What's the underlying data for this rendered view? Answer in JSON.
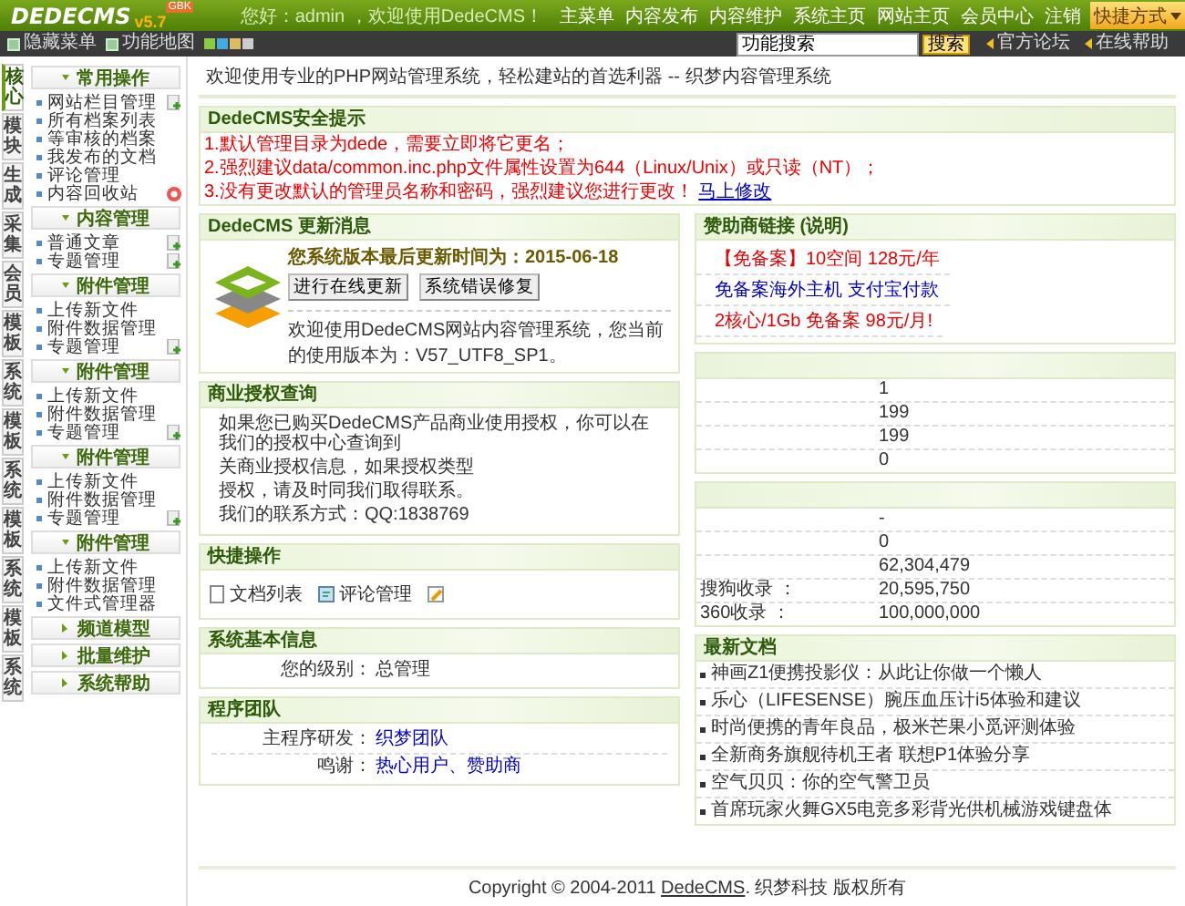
{
  "header": {
    "logo": "DEDECMS",
    "version": "v5.7",
    "edition": "GBK",
    "greeting": "您好：admin ，欢迎使用DedeCMS！",
    "nav": [
      "主菜单",
      "内容发布",
      "内容维护",
      "系统主页",
      "网站主页",
      "会员中心",
      "注销"
    ],
    "shortcut": "快捷方式"
  },
  "toolbar": {
    "links": [
      "隐藏菜单",
      "功能地图"
    ],
    "search": {
      "value": "功能搜索",
      "button": "搜索"
    },
    "help_links": [
      "官方论坛",
      "在线帮助"
    ]
  },
  "side_tabs": [
    {
      "label": "核心",
      "selected": true
    },
    {
      "label": "模块",
      "selected": false
    },
    {
      "label": "生成",
      "selected": false
    },
    {
      "label": "采集",
      "selected": false
    },
    {
      "label": "会员",
      "selected": false
    },
    {
      "label": "模板",
      "selected": false
    },
    {
      "label": "系统",
      "selected": false
    },
    {
      "label": "模板",
      "selected": false
    },
    {
      "label": "系统",
      "selected": false
    },
    {
      "label": "模板",
      "selected": false
    },
    {
      "label": "系统",
      "selected": false
    },
    {
      "label": "模板",
      "selected": false
    },
    {
      "label": "系统",
      "selected": false
    }
  ],
  "menu": [
    {
      "title": "常用操作",
      "expanded": true,
      "items": [
        {
          "label": "网站栏目管理",
          "kind": "add"
        },
        {
          "label": "所有档案列表",
          "kind": "plain"
        },
        {
          "label": "等审核的档案",
          "kind": "plain"
        },
        {
          "label": "我发布的文档",
          "kind": "plain"
        },
        {
          "label": "评论管理",
          "kind": "plain"
        },
        {
          "label": "内容回收站",
          "kind": "trash"
        }
      ]
    },
    {
      "title": "内容管理",
      "expanded": true,
      "items": [
        {
          "label": "普通文章",
          "kind": "add"
        },
        {
          "label": "专题管理",
          "kind": "add"
        }
      ]
    },
    {
      "title": "附件管理",
      "expanded": true,
      "items": [
        {
          "label": "上传新文件",
          "kind": "plain"
        },
        {
          "label": "附件数据管理",
          "kind": "plain"
        },
        {
          "label": "专题管理",
          "kind": "add"
        }
      ]
    },
    {
      "title": "附件管理",
      "expanded": true,
      "items": [
        {
          "label": "上传新文件",
          "kind": "plain"
        },
        {
          "label": "附件数据管理",
          "kind": "plain"
        },
        {
          "label": "专题管理",
          "kind": "add"
        }
      ]
    },
    {
      "title": "附件管理",
      "expanded": true,
      "items": [
        {
          "label": "上传新文件",
          "kind": "plain"
        },
        {
          "label": "附件数据管理",
          "kind": "plain"
        },
        {
          "label": "专题管理",
          "kind": "add"
        }
      ]
    },
    {
      "title": "附件管理",
      "expanded": true,
      "items": [
        {
          "label": "上传新文件",
          "kind": "plain"
        },
        {
          "label": "附件数据管理",
          "kind": "plain"
        },
        {
          "label": "文件式管理器",
          "kind": "plain"
        }
      ]
    },
    {
      "title": "频道模型",
      "expanded": false
    },
    {
      "title": "批量维护",
      "expanded": false
    },
    {
      "title": "系统帮助",
      "expanded": false
    }
  ],
  "welcome": "欢迎使用专业的PHP网站管理系统，轻松建站的首选利器 -- 织梦内容管理系统",
  "security": {
    "title": "DedeCMS安全提示",
    "notices": [
      "1.默认管理目录为dede，需要立即将它更名；",
      "2.强烈建议data/common.inc.php文件属性设置为644（Linux/Unix）或只读（NT）；",
      "3.没有更改默认的管理员名称和密码，强烈建议您进行更改！"
    ],
    "link": "马上修改"
  },
  "update": {
    "title": "DedeCMS 更新消息",
    "update_time": "您系统版本最后更新时间为：2015-06-18",
    "buttons": [
      "进行在线更新",
      "系统错误修复"
    ],
    "version_text": "欢迎使用DedeCMS网站内容管理系统，您当前的使用版本为：V57_UTF8_SP1。"
  },
  "auth": {
    "title": "商业授权查询",
    "lines": [
      "如果您已购买DedeCMS产品商业使用授权，你可以在我们的授权中心查询到",
      "关商业授权信息，如果授权类型",
      "授权，请及时同我们取得联系。",
      "我们的联系方式：QQ:1838769"
    ]
  },
  "quick_ops": {
    "title": "快捷操作",
    "items": [
      {
        "label": "文档列表",
        "kind": "list"
      },
      {
        "label": "评论管理",
        "kind": "comment"
      },
      {
        "kind": "edit"
      }
    ]
  },
  "system_info": {
    "title": "系统基本信息",
    "rows": [
      {
        "label": "您的级别：",
        "value": "总管理"
      }
    ]
  },
  "team": {
    "title": "程序团队",
    "rows": [
      {
        "label": "主程序研发：",
        "value": "织梦团队"
      },
      {
        "label": "鸣谢：",
        "value": "热心用户、赞助商"
      }
    ]
  },
  "sponsor": {
    "title": "赞助商链接 **(说明)**",
    "links": [
      {
        "text": "【免备案】10空间 128元/年",
        "kind": "promo"
      },
      {
        "text": "免备案海外主机 支付宝付款",
        "kind": "link"
      },
      {
        "text": "2核心/1Gb 免备案 98元/月!",
        "kind": "promo"
      }
    ]
  },
  "stats": {
    "rows": [
      {
        "value": "1"
      },
      {
        "value": "199"
      },
      {
        "value": "199"
      },
      {
        "value": "0"
      }
    ]
  },
  "index_stats": {
    "rows": [
      {
        "value": "-"
      },
      {
        "value": "0"
      },
      {
        "value": "62,304,479"
      },
      {
        "label": "搜狗收录 ：",
        "value": "20,595,750"
      },
      {
        "label": "360收录 ：",
        "value": "100,000,000"
      }
    ]
  },
  "latest": {
    "title": "最新文档",
    "items": [
      "神画Z1便携投影仪：从此让你做一个懒人",
      "乐心（LIFESENSE）腕压血压计i5体验和建议",
      "时尚便携的青年良品，极米芒果小觅评测体验",
      "全新商务旗舰待机王者 联想P1体验分享",
      "空气贝贝：你的空气警卫员",
      "首席玩家火舞GX5电竞多彩背光供机械游戏键盘体"
    ]
  },
  "footer": {
    "text_before": "Copyright © 2004-2011 ",
    "link": "DedeCMS",
    "text_after": ". 织梦科技 版权所有"
  }
}
